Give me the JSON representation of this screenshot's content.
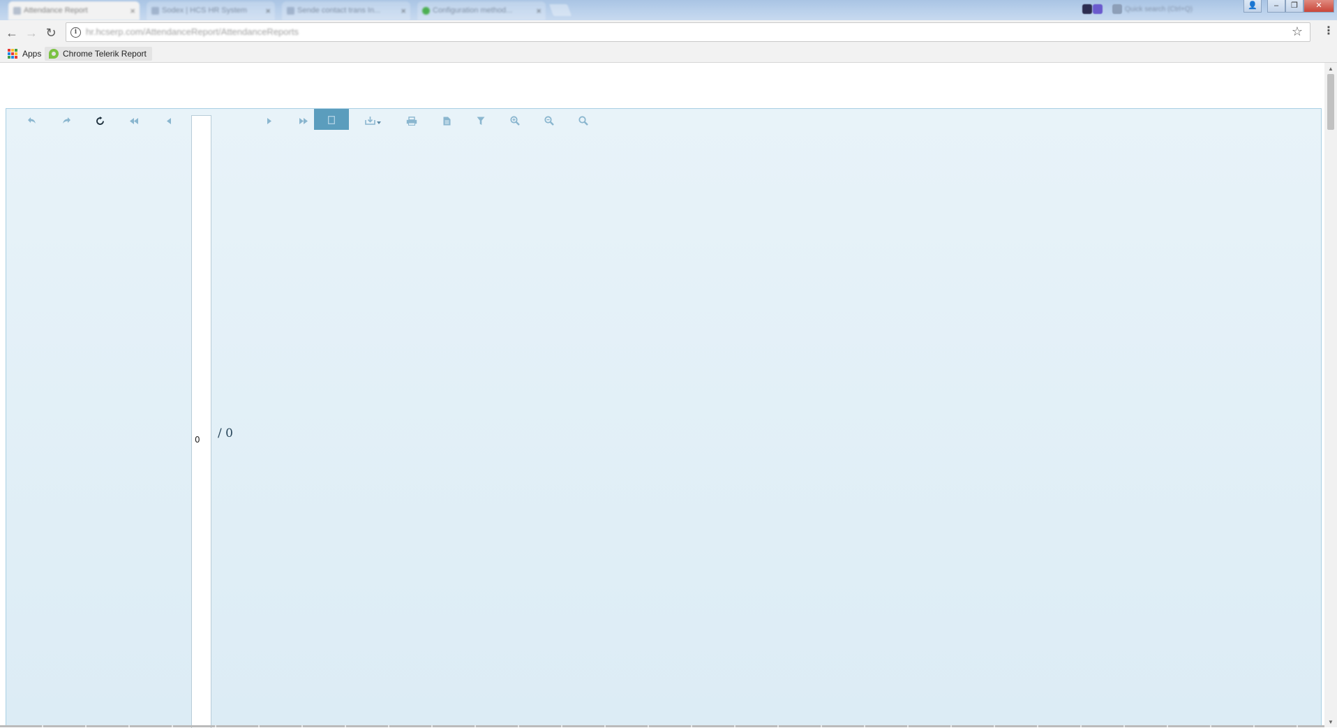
{
  "browser": {
    "tabs": [
      {
        "title": "Attendance Report",
        "active": true
      },
      {
        "title": "Sodex | HCS HR System",
        "active": false
      },
      {
        "title": "Sende contact trans In...",
        "active": false
      },
      {
        "title": "Configuration method...",
        "active": false
      }
    ],
    "tab_close_glyph": "×",
    "tray_search_text": "Quick search (Ctrl+Q)",
    "window_buttons": {
      "user": "👤",
      "minimize": "–",
      "restore": "❐",
      "close": "✕"
    },
    "nav": {
      "back": "←",
      "forward": "→",
      "reload": "↻"
    },
    "address": {
      "url": "hr.hcserp.com/AttendanceReport/AttendanceReports",
      "info_glyph": "i",
      "star_glyph": "☆"
    },
    "menu_glyph": "⋮",
    "bookmarks": [
      {
        "label": "Apps",
        "icon": "apps-grid-icon"
      },
      {
        "label": "Chrome Telerik Report",
        "icon": "telerik-icon"
      }
    ]
  },
  "viewer": {
    "toolbar": [
      {
        "name": "navigate-back-button",
        "icon": "undo-arrow-icon",
        "glyph": "⮌",
        "enabled": false
      },
      {
        "name": "navigate-forward-button",
        "icon": "redo-arrow-icon",
        "glyph": "⮎",
        "enabled": false
      },
      {
        "name": "refresh-report-button",
        "icon": "refresh-icon",
        "glyph": "↻",
        "enabled": true
      },
      {
        "name": "first-page-button",
        "icon": "first-page-icon",
        "glyph": "◂◂",
        "enabled": false
      },
      {
        "name": "previous-page-button",
        "icon": "previous-page-icon",
        "glyph": "◂",
        "enabled": false
      },
      {
        "name": "next-page-button",
        "icon": "next-page-icon",
        "glyph": "▸",
        "enabled": false
      },
      {
        "name": "last-page-button",
        "icon": "last-page-icon",
        "glyph": "▸▸",
        "enabled": false
      },
      {
        "name": "print-preview-toggle",
        "icon": "page-icon",
        "glyph": "▢",
        "enabled": true
      },
      {
        "name": "export-button",
        "icon": "export-download-icon",
        "glyph": "⤓▾",
        "enabled": false
      },
      {
        "name": "print-button",
        "icon": "print-icon",
        "glyph": "🖶",
        "enabled": false
      },
      {
        "name": "document-map-button",
        "icon": "document-icon",
        "glyph": "🗎",
        "enabled": false
      },
      {
        "name": "parameters-button",
        "icon": "filter-icon",
        "glyph": "⏷",
        "enabled": false
      },
      {
        "name": "zoom-in-button",
        "icon": "zoom-in-icon",
        "glyph": "🔍",
        "enabled": false
      },
      {
        "name": "zoom-out-button",
        "icon": "zoom-out-icon",
        "glyph": "🔍",
        "enabled": false
      },
      {
        "name": "search-button",
        "icon": "search-icon",
        "glyph": "🔍",
        "enabled": false
      }
    ],
    "page_number_value": "0",
    "page_total": "/ 0",
    "colors": {
      "background_top": "#e8f3f9",
      "background_bottom": "#dcecf5",
      "border": "#a8cfe3",
      "icon_disabled": "#8ab6cf",
      "icon_active": "#1b2d3a",
      "toggle_bg": "#5b9dbd"
    }
  }
}
